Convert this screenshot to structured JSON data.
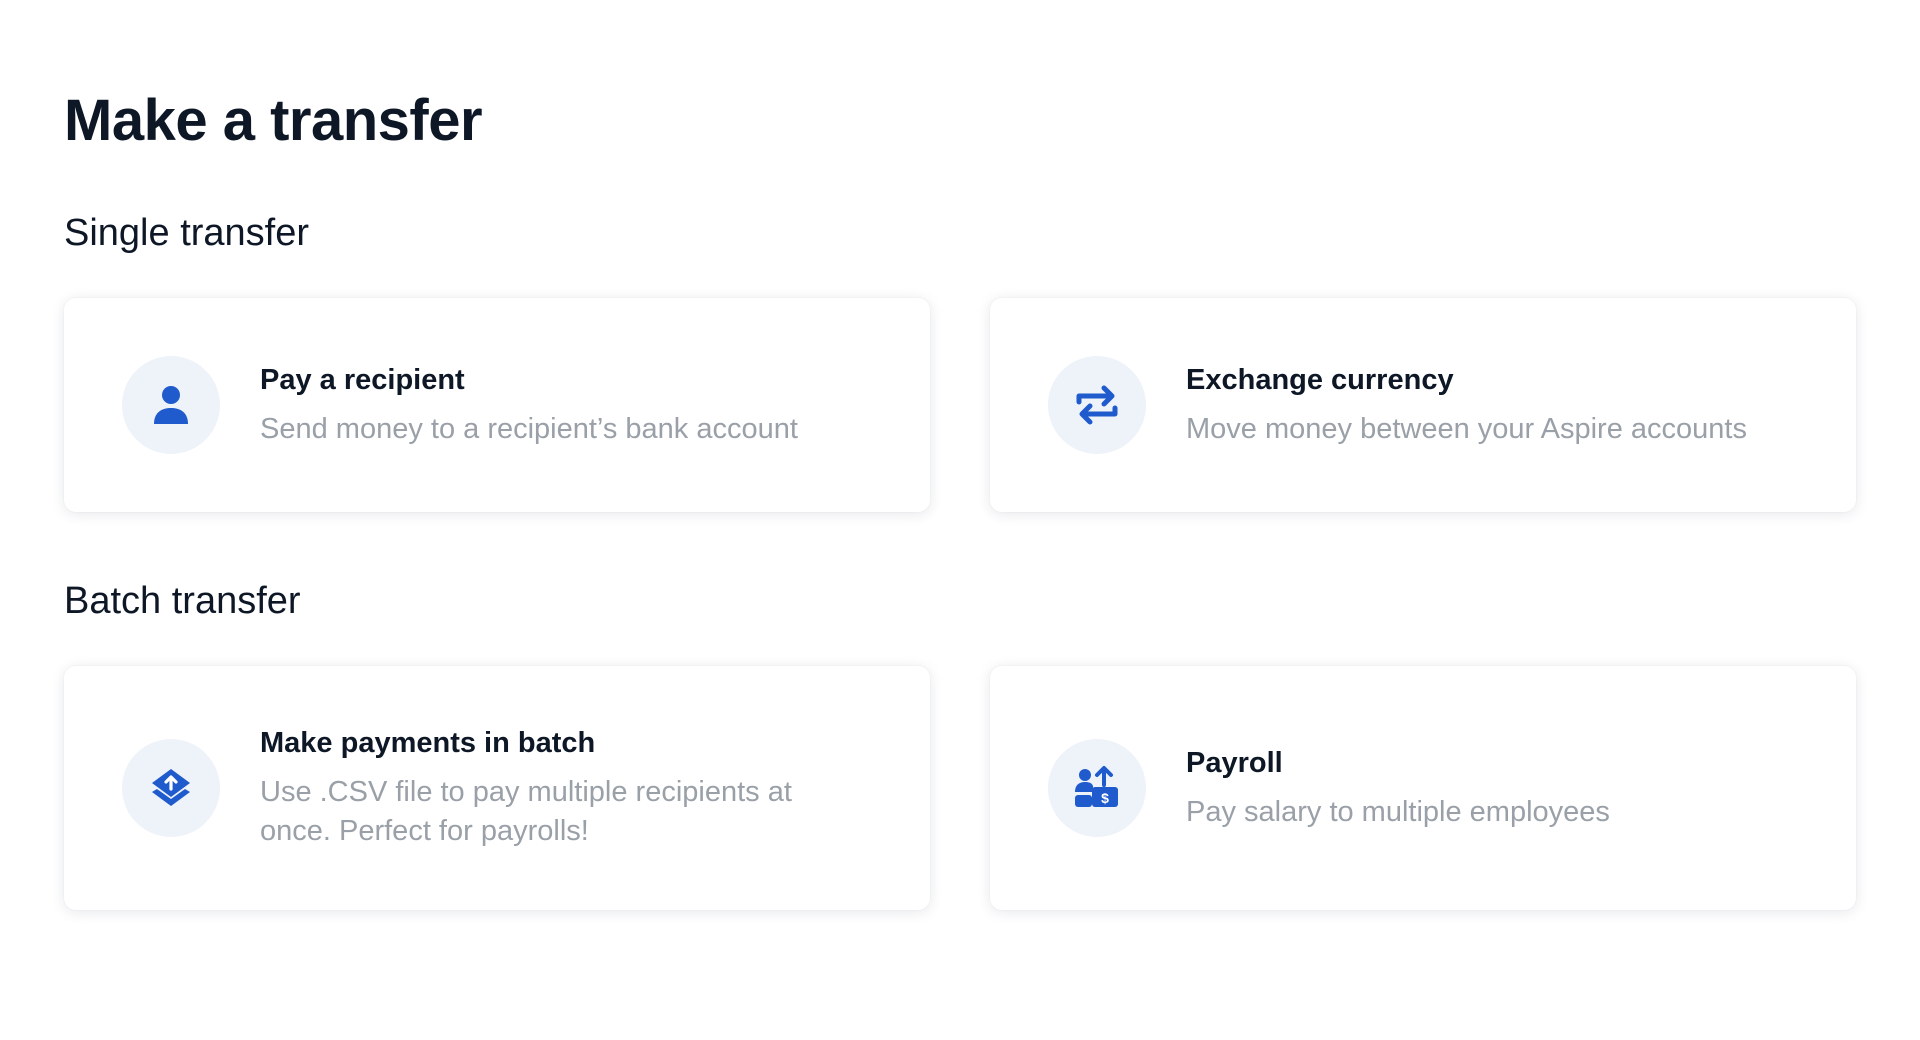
{
  "page": {
    "title": "Make a transfer"
  },
  "sections": [
    {
      "title": "Single transfer",
      "cards": [
        {
          "title": "Pay a recipient",
          "description": "Send money to a recipient’s bank account",
          "icon": "person-icon"
        },
        {
          "title": "Exchange currency",
          "description": "Move money between your Aspire accounts",
          "icon": "exchange-arrows-icon"
        }
      ]
    },
    {
      "title": "Batch transfer",
      "cards": [
        {
          "title": "Make payments in batch",
          "description": "Use .CSV file to pay multiple recipients at once. Perfect for payrolls!",
          "icon": "batch-upload-icon"
        },
        {
          "title": "Payroll",
          "description": "Pay salary to multiple employees",
          "icon": "payroll-icon"
        }
      ]
    }
  ],
  "colors": {
    "icon_blue": "#1f5bcc",
    "icon_bg": "#eef2f9",
    "title_text": "#0d1726",
    "muted_text": "#9aa0a8"
  }
}
